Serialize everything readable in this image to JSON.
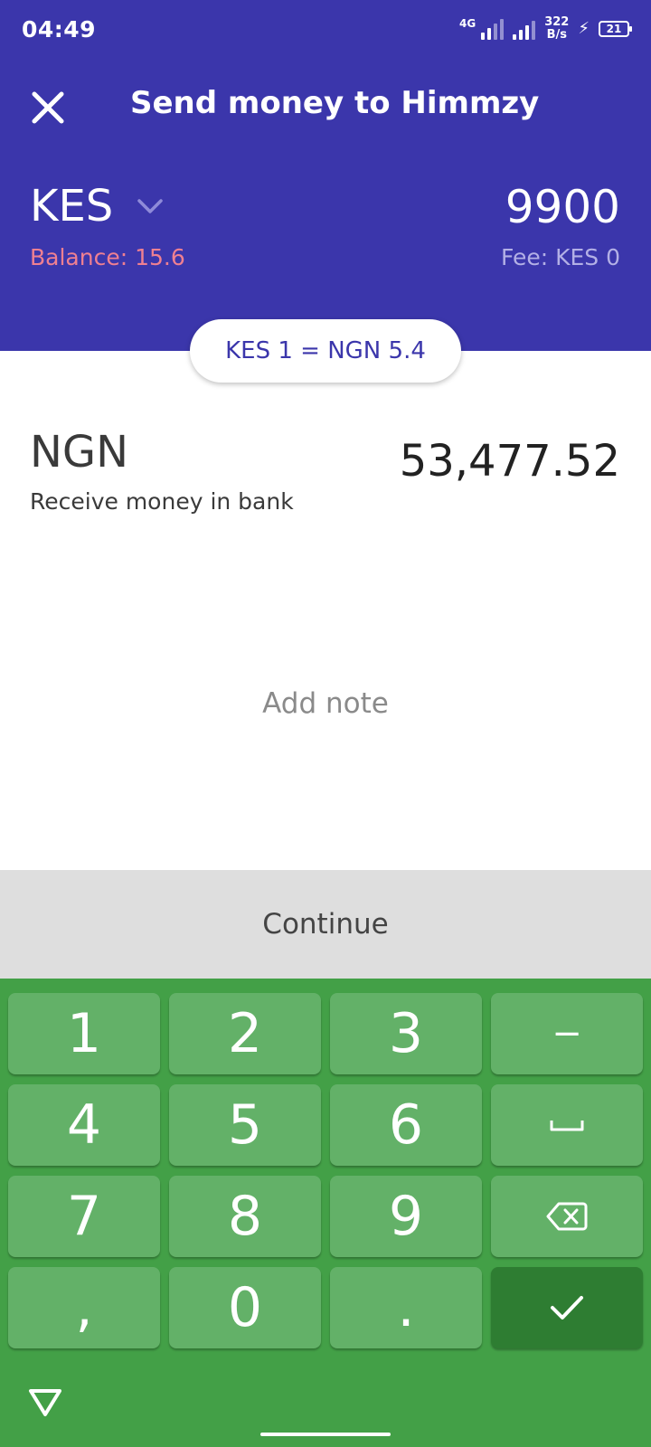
{
  "status": {
    "time": "04:49",
    "network": "4G",
    "speed_value": "322",
    "speed_unit": "B/s",
    "battery": "21"
  },
  "header": {
    "title": "Send money to Himmzy",
    "close_icon": "close-icon"
  },
  "send": {
    "currency": "KES",
    "balance": "Balance: 15.6",
    "amount": "9900",
    "fee": "Fee: KES 0"
  },
  "rate": {
    "text": "KES 1 = NGN 5.4"
  },
  "receive": {
    "currency": "NGN",
    "description": "Receive money in bank",
    "amount": "53,477.52"
  },
  "note": {
    "label": "Add note"
  },
  "actions": {
    "continue_label": "Continue"
  },
  "keypad": {
    "digits": [
      "1",
      "2",
      "3",
      "4",
      "5",
      "6",
      "7",
      "8",
      "9",
      ",",
      "0",
      "."
    ],
    "minus": "−",
    "icons": [
      "space-icon",
      "backspace-icon",
      "checkmark-icon"
    ]
  },
  "colors": {
    "header_bg": "#3b36ab",
    "balance_text": "#ef8091",
    "continue_bg": "#dedede",
    "keypad_bg": "#43a047",
    "key_bg": "#63b168",
    "confirm_key_bg": "#2e7d32"
  }
}
